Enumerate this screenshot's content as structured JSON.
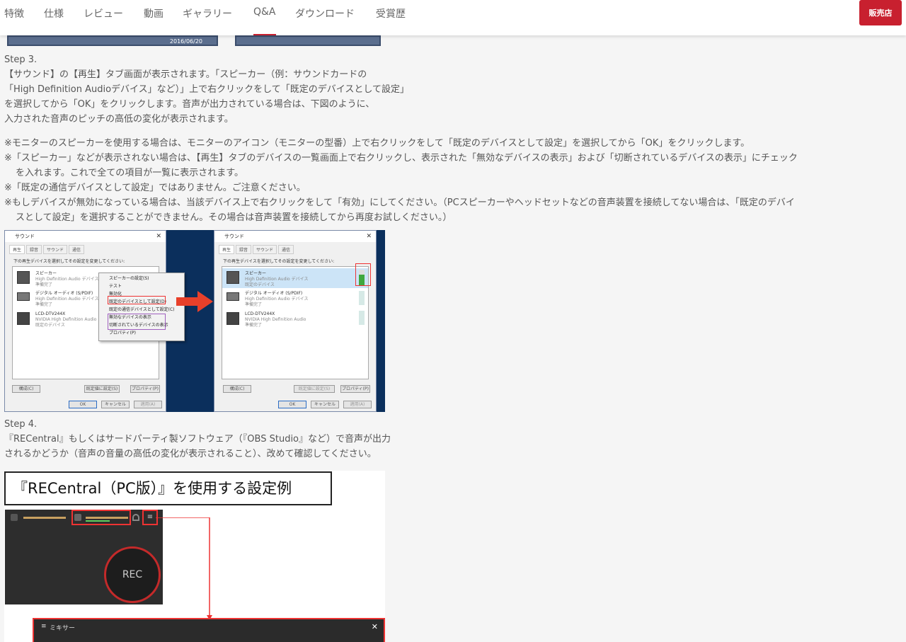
{
  "nav": {
    "tabs": [
      "特徴",
      "仕様",
      "レビュー",
      "動画",
      "ギャラリー",
      "Q&A",
      "ダウンロード",
      "受賞歴"
    ],
    "active_tab": "Q&A",
    "dealer_button": "販売店"
  },
  "prev_strip": {
    "date": "2016/06/20"
  },
  "step3": {
    "title": "Step 3.",
    "lines": [
      "【サウンド】の【再生】タブ画面が表示されます。「スピーカー（例：サウンドカードの",
      "「High Definition Audioデバイス」など）」上で右クリックをして「既定のデバイスとして設定」",
      "を選択してから「OK」をクリックします。音声が出力されている場合は、下図のように、",
      "入力された音声のピッチの高低の変化が表示されます。"
    ]
  },
  "notes": {
    "n1": "※モニターのスピーカーを使用する場合は、モニターのアイコン（モニターの型番）上で右クリックをして「既定のデバイスとして設定」を選択してから「OK」をクリックします。",
    "n2a": "※「スピーカー」などが表示されない場合は、【再生】タブのデバイスの一覧画面上で右クリックし、表示された「無効なデバイスの表示」および「切断されているデバイスの表示」にチェック",
    "n2b": "を入れます。これで全ての項目が一覧に表示されます。",
    "n3": "※「既定の通信デバイスとして設定」ではありません。ご注意ください。",
    "n4a": "※もしデバイスが無効になっている場合は、当該デバイス上で右クリックをして「有効」にしてください。（PCスピーカーやヘッドセットなどの音声装置を接続してない場合は、「既定のデバイ",
    "n4b": "スとして設定」を選択することができません。その場合は音声装置を接続してから再度お試しください。）"
  },
  "sound_dialog": {
    "title": "サウンド",
    "tabs": [
      "再生",
      "録音",
      "サウンド",
      "通信"
    ],
    "instruction": "下の再生デバイスを選択してその設定を変更してください:",
    "devices": [
      {
        "name": "スピーカー",
        "sub1": "High Definition Audio デバイス",
        "sub2": "準備完了"
      },
      {
        "name": "デジタル オーディオ (S/PDIF)",
        "sub1": "High Definition Audio デバイス",
        "sub2": "準備完了"
      },
      {
        "name": "LCD-DTV244X",
        "sub1": "NVIDIA High Definition Audio",
        "sub2": "既定のデバイス"
      }
    ],
    "devices_after": [
      {
        "name": "スピーカー",
        "sub1": "High Definition Audio デバイス",
        "sub2": "既定のデバイス"
      },
      {
        "name": "デジタル オーディオ (S/PDIF)",
        "sub1": "High Definition Audio デバイス",
        "sub2": "準備完了"
      },
      {
        "name": "LCD-DTV244X",
        "sub1": "NVIDIA High Definition Audio",
        "sub2": "準備完了"
      }
    ],
    "context_menu": [
      "スピーカーの設定(S)",
      "テスト",
      "無効化",
      "既定のデバイスとして設定(D)",
      "既定の通信デバイスとして設定(C)",
      "無効なデバイスの表示",
      "切断されているデバイスの表示",
      "プロパティ(P)"
    ],
    "btn_configure": "構成(C)",
    "btn_set_default": "既定値に設定(S)",
    "btn_properties": "プロパティ(P)",
    "btn_ok": "OK",
    "btn_cancel": "キャンセル",
    "btn_apply": "適用(A)"
  },
  "step4": {
    "title": "Step 4.",
    "lines": [
      "『RECentral』もしくはサードパーティ製ソフトウェア（『OBS Studio』など）で音声が出力",
      "されるかどうか（音声の音量の高低の変化が表示されること）、改めて確認してください。"
    ]
  },
  "recentral": {
    "heading": "『RECentral（PC版）』を使用する設定例",
    "rec_label": "REC",
    "mixer_title": "ミキサー",
    "mixer_close": "✕"
  },
  "colors": {
    "accent": "#c8202f",
    "win_blue": "#0b2f5c"
  }
}
